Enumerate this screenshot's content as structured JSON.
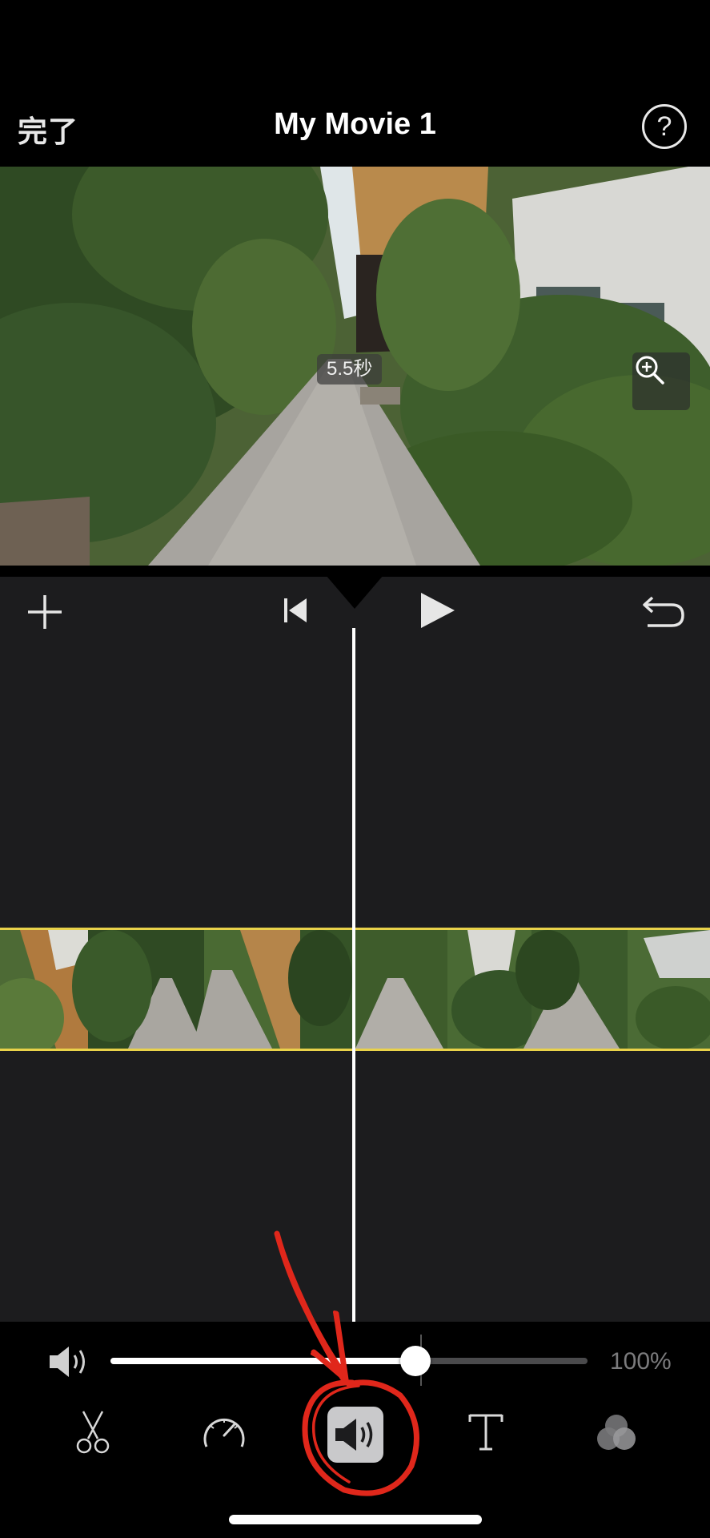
{
  "header": {
    "done_label": "完了",
    "title": "My Movie 1",
    "help_label": "?"
  },
  "preview": {
    "duration": "5.5秒",
    "zoom_icon": "zoom-in-icon"
  },
  "timeline_toolbar": {
    "add_icon": "plus-icon",
    "rewind_icon": "skip-to-start-icon",
    "play_icon": "play-icon",
    "undo_icon": "undo-icon"
  },
  "clips": [
    {
      "name": "clip-1",
      "selected": true
    },
    {
      "name": "clip-2",
      "selected": true
    }
  ],
  "volume": {
    "icon": "speaker-icon",
    "level": 0.64,
    "value_label": "100%"
  },
  "tools": [
    {
      "name": "split-tool",
      "icon": "scissors-icon",
      "active": false
    },
    {
      "name": "speed-tool",
      "icon": "speedometer-icon",
      "active": false
    },
    {
      "name": "volume-tool",
      "icon": "speaker-icon",
      "active": true
    },
    {
      "name": "title-tool",
      "icon": "text-icon",
      "active": false
    },
    {
      "name": "filter-tool",
      "icon": "filters-icon",
      "active": false
    }
  ],
  "colors": {
    "clip_border": "#e9d24a",
    "timeline_bg": "#1c1c1e",
    "annotation": "#e0271b"
  }
}
